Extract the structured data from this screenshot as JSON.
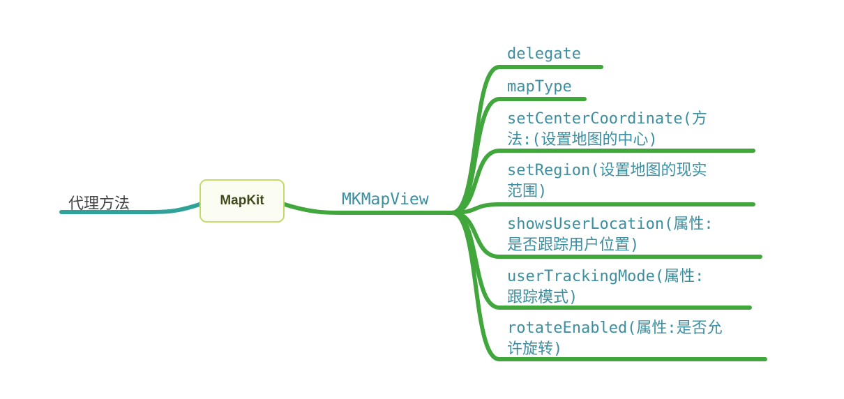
{
  "root": {
    "label": "MapKit"
  },
  "left_branch": {
    "label": "代理方法"
  },
  "hub": {
    "label": "MKMapView"
  },
  "leaves": [
    {
      "lines": [
        "delegate"
      ]
    },
    {
      "lines": [
        "mapType"
      ]
    },
    {
      "lines": [
        "setCenterCoordinate(方",
        "法:(设置地图的中心)"
      ]
    },
    {
      "lines": [
        "setRegion(设置地图的现实",
        "范围)"
      ]
    },
    {
      "lines": [
        "showsUserLocation(属性:",
        "是否跟踪用户位置)"
      ]
    },
    {
      "lines": [
        "userTrackingMode(属性:",
        "跟踪模式)"
      ]
    },
    {
      "lines": [
        "rotateEnabled(属性:是否允",
        "许旋转)"
      ]
    }
  ],
  "colors": {
    "green_branch": "#41a63c",
    "teal_branch": "#2fa39a",
    "root_border": "#c2dc6a",
    "label_text": "#3d8fa0"
  }
}
